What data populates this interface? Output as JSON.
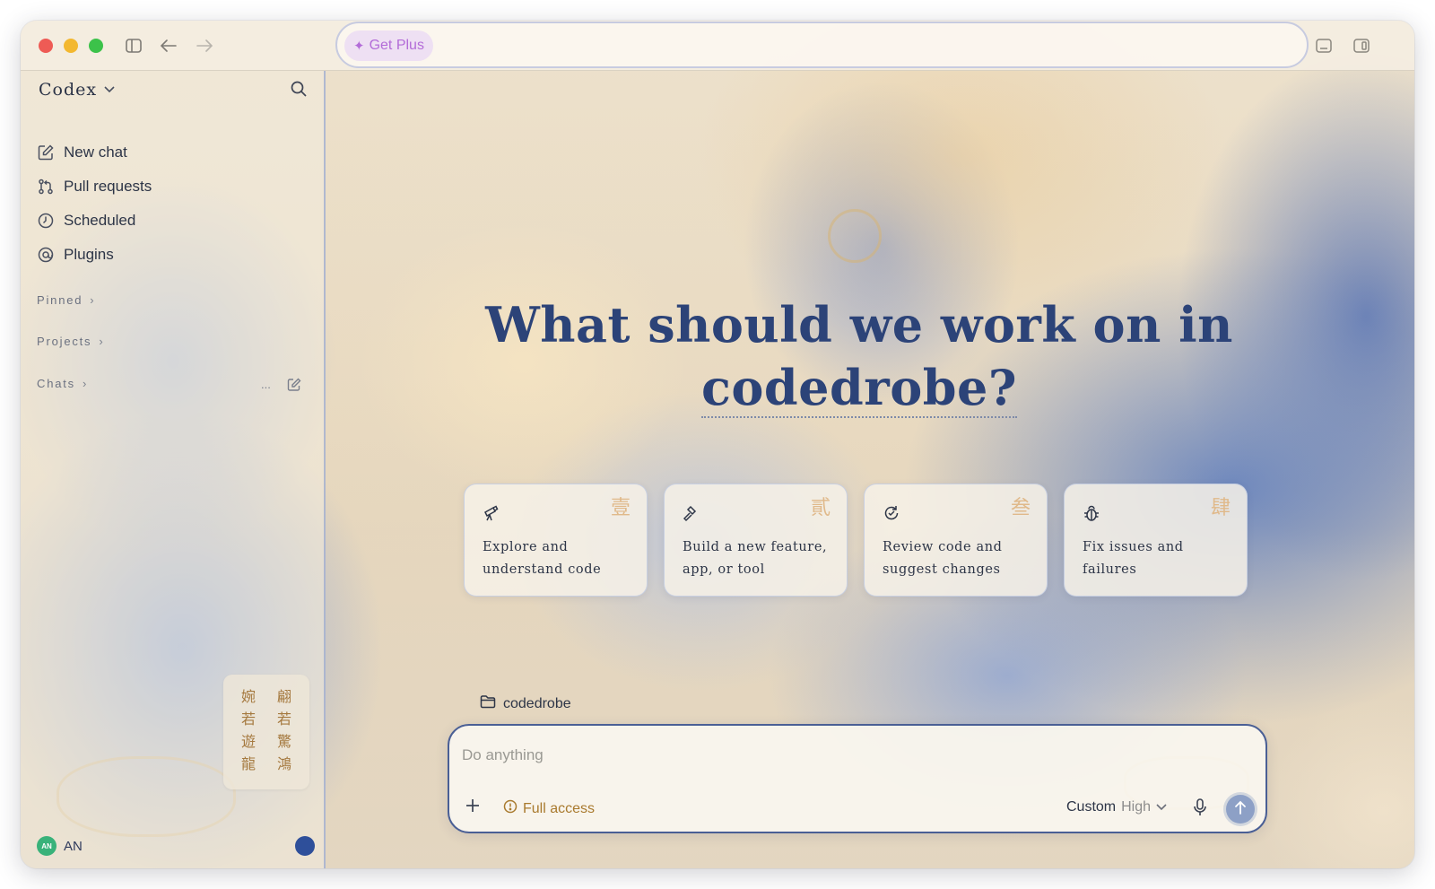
{
  "window": {
    "toolbar": {
      "get_plus": "Get Plus"
    }
  },
  "sidebar": {
    "app_title": "Codex",
    "nav": [
      {
        "label": "New chat",
        "icon": "edit-icon"
      },
      {
        "label": "Pull requests",
        "icon": "pull-request-icon"
      },
      {
        "label": "Scheduled",
        "icon": "clock-icon"
      },
      {
        "label": "Plugins",
        "icon": "plugin-icon"
      }
    ],
    "sections": {
      "pinned": "Pinned",
      "projects": "Projects",
      "chats": "Chats",
      "chats_more": "..."
    },
    "seal": {
      "col1": [
        "婉",
        "若",
        "遊",
        "龍"
      ],
      "col2": [
        "翩",
        "若",
        "驚",
        "鴻"
      ]
    },
    "account": {
      "initials": "AN",
      "name": "AN",
      "avatar_color": "#39b27a"
    }
  },
  "main": {
    "heading_line1": "What should we work on in",
    "heading_repo": "codedrobe?",
    "cards": [
      {
        "label": "Explore and understand code",
        "num": "壹",
        "icon": "telescope-icon"
      },
      {
        "label": "Build a new feature, app, or tool",
        "num": "貳",
        "icon": "hammer-icon"
      },
      {
        "label": "Review code and suggest changes",
        "num": "叁",
        "icon": "review-icon"
      },
      {
        "label": "Fix issues and failures",
        "num": "肆",
        "icon": "bug-icon"
      }
    ],
    "project": "codedrobe",
    "composer": {
      "placeholder": "Do anything",
      "access": "Full access",
      "model": "Custom",
      "effort": "High"
    }
  },
  "colors": {
    "accent": "#2c4378",
    "get_plus": "#b36cd8",
    "access": "#a97a2e"
  }
}
